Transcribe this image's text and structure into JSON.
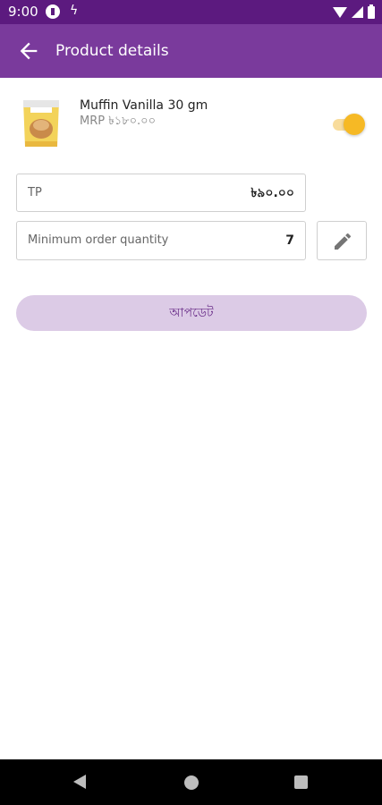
{
  "status_bar": {
    "time": "9:00",
    "icons": [
      "app-notification-icon",
      "bolt-icon",
      "wifi-icon",
      "signal-icon",
      "battery-icon"
    ]
  },
  "app_bar": {
    "title": "Product details",
    "back_icon": "arrow-back-icon",
    "background": "#7a3a9c"
  },
  "product": {
    "name": "Muffin Vanilla 30 gm",
    "mrp": "MRP ৳১৮০.০০",
    "thumbnail": "product-pack-icon",
    "enabled": true
  },
  "fields": {
    "tp": {
      "label": "TP",
      "value": "৳৯০.০০"
    },
    "min_order_qty": {
      "label": "Minimum order quantity",
      "value": "7"
    }
  },
  "actions": {
    "edit_icon": "pencil-icon",
    "update_label": "আপডেট"
  },
  "colors": {
    "status_bar": "#5c1a7f",
    "primary": "#7a3a9c",
    "toggle_on": "#f6b925",
    "update_button_bg": "#dccbe6",
    "update_button_text": "#6b2f8a"
  },
  "nav_bar": {
    "icons": [
      "nav-back-icon",
      "nav-home-icon",
      "nav-recents-icon"
    ]
  }
}
